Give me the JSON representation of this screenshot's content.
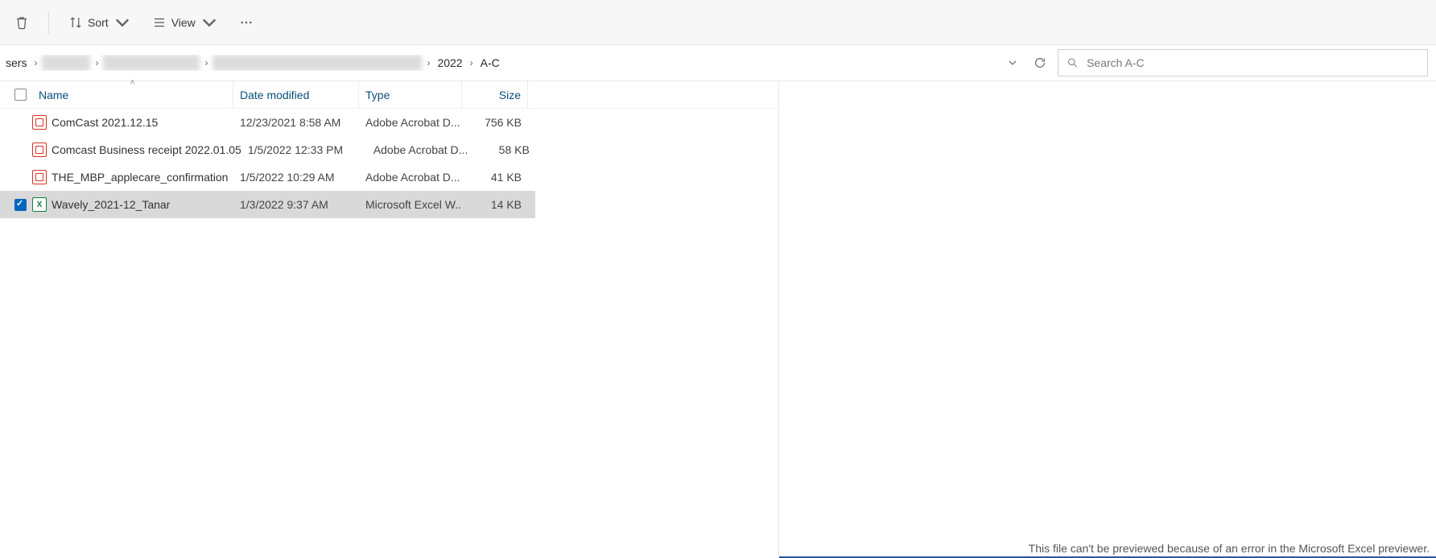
{
  "toolbar": {
    "sort_label": "Sort",
    "view_label": "View"
  },
  "breadcrumbs": {
    "root": "sers",
    "visible": [
      "2022",
      "A-C"
    ]
  },
  "search": {
    "placeholder": "Search A-C"
  },
  "columns": {
    "name": "Name",
    "date": "Date modified",
    "type": "Type",
    "size": "Size"
  },
  "files": [
    {
      "icon": "pdf",
      "name": "ComCast 2021.12.15",
      "date": "12/23/2021 8:58 AM",
      "type": "Adobe Acrobat D...",
      "size": "756 KB",
      "selected": false
    },
    {
      "icon": "pdf",
      "name": "Comcast Business receipt 2022.01.05",
      "date": "1/5/2022 12:33 PM",
      "type": "Adobe Acrobat D...",
      "size": "58 KB",
      "selected": false
    },
    {
      "icon": "pdf",
      "name": "THE_MBP_applecare_confirmation",
      "date": "1/5/2022 10:29 AM",
      "type": "Adobe Acrobat D...",
      "size": "41 KB",
      "selected": false
    },
    {
      "icon": "xls",
      "name": "Wavely_2021-12_Tanar",
      "date": "1/3/2022 9:37 AM",
      "type": "Microsoft Excel W...",
      "size": "14 KB",
      "selected": true
    }
  ],
  "preview": {
    "error": "This file can't be previewed because of an error in the Microsoft Excel previewer."
  }
}
